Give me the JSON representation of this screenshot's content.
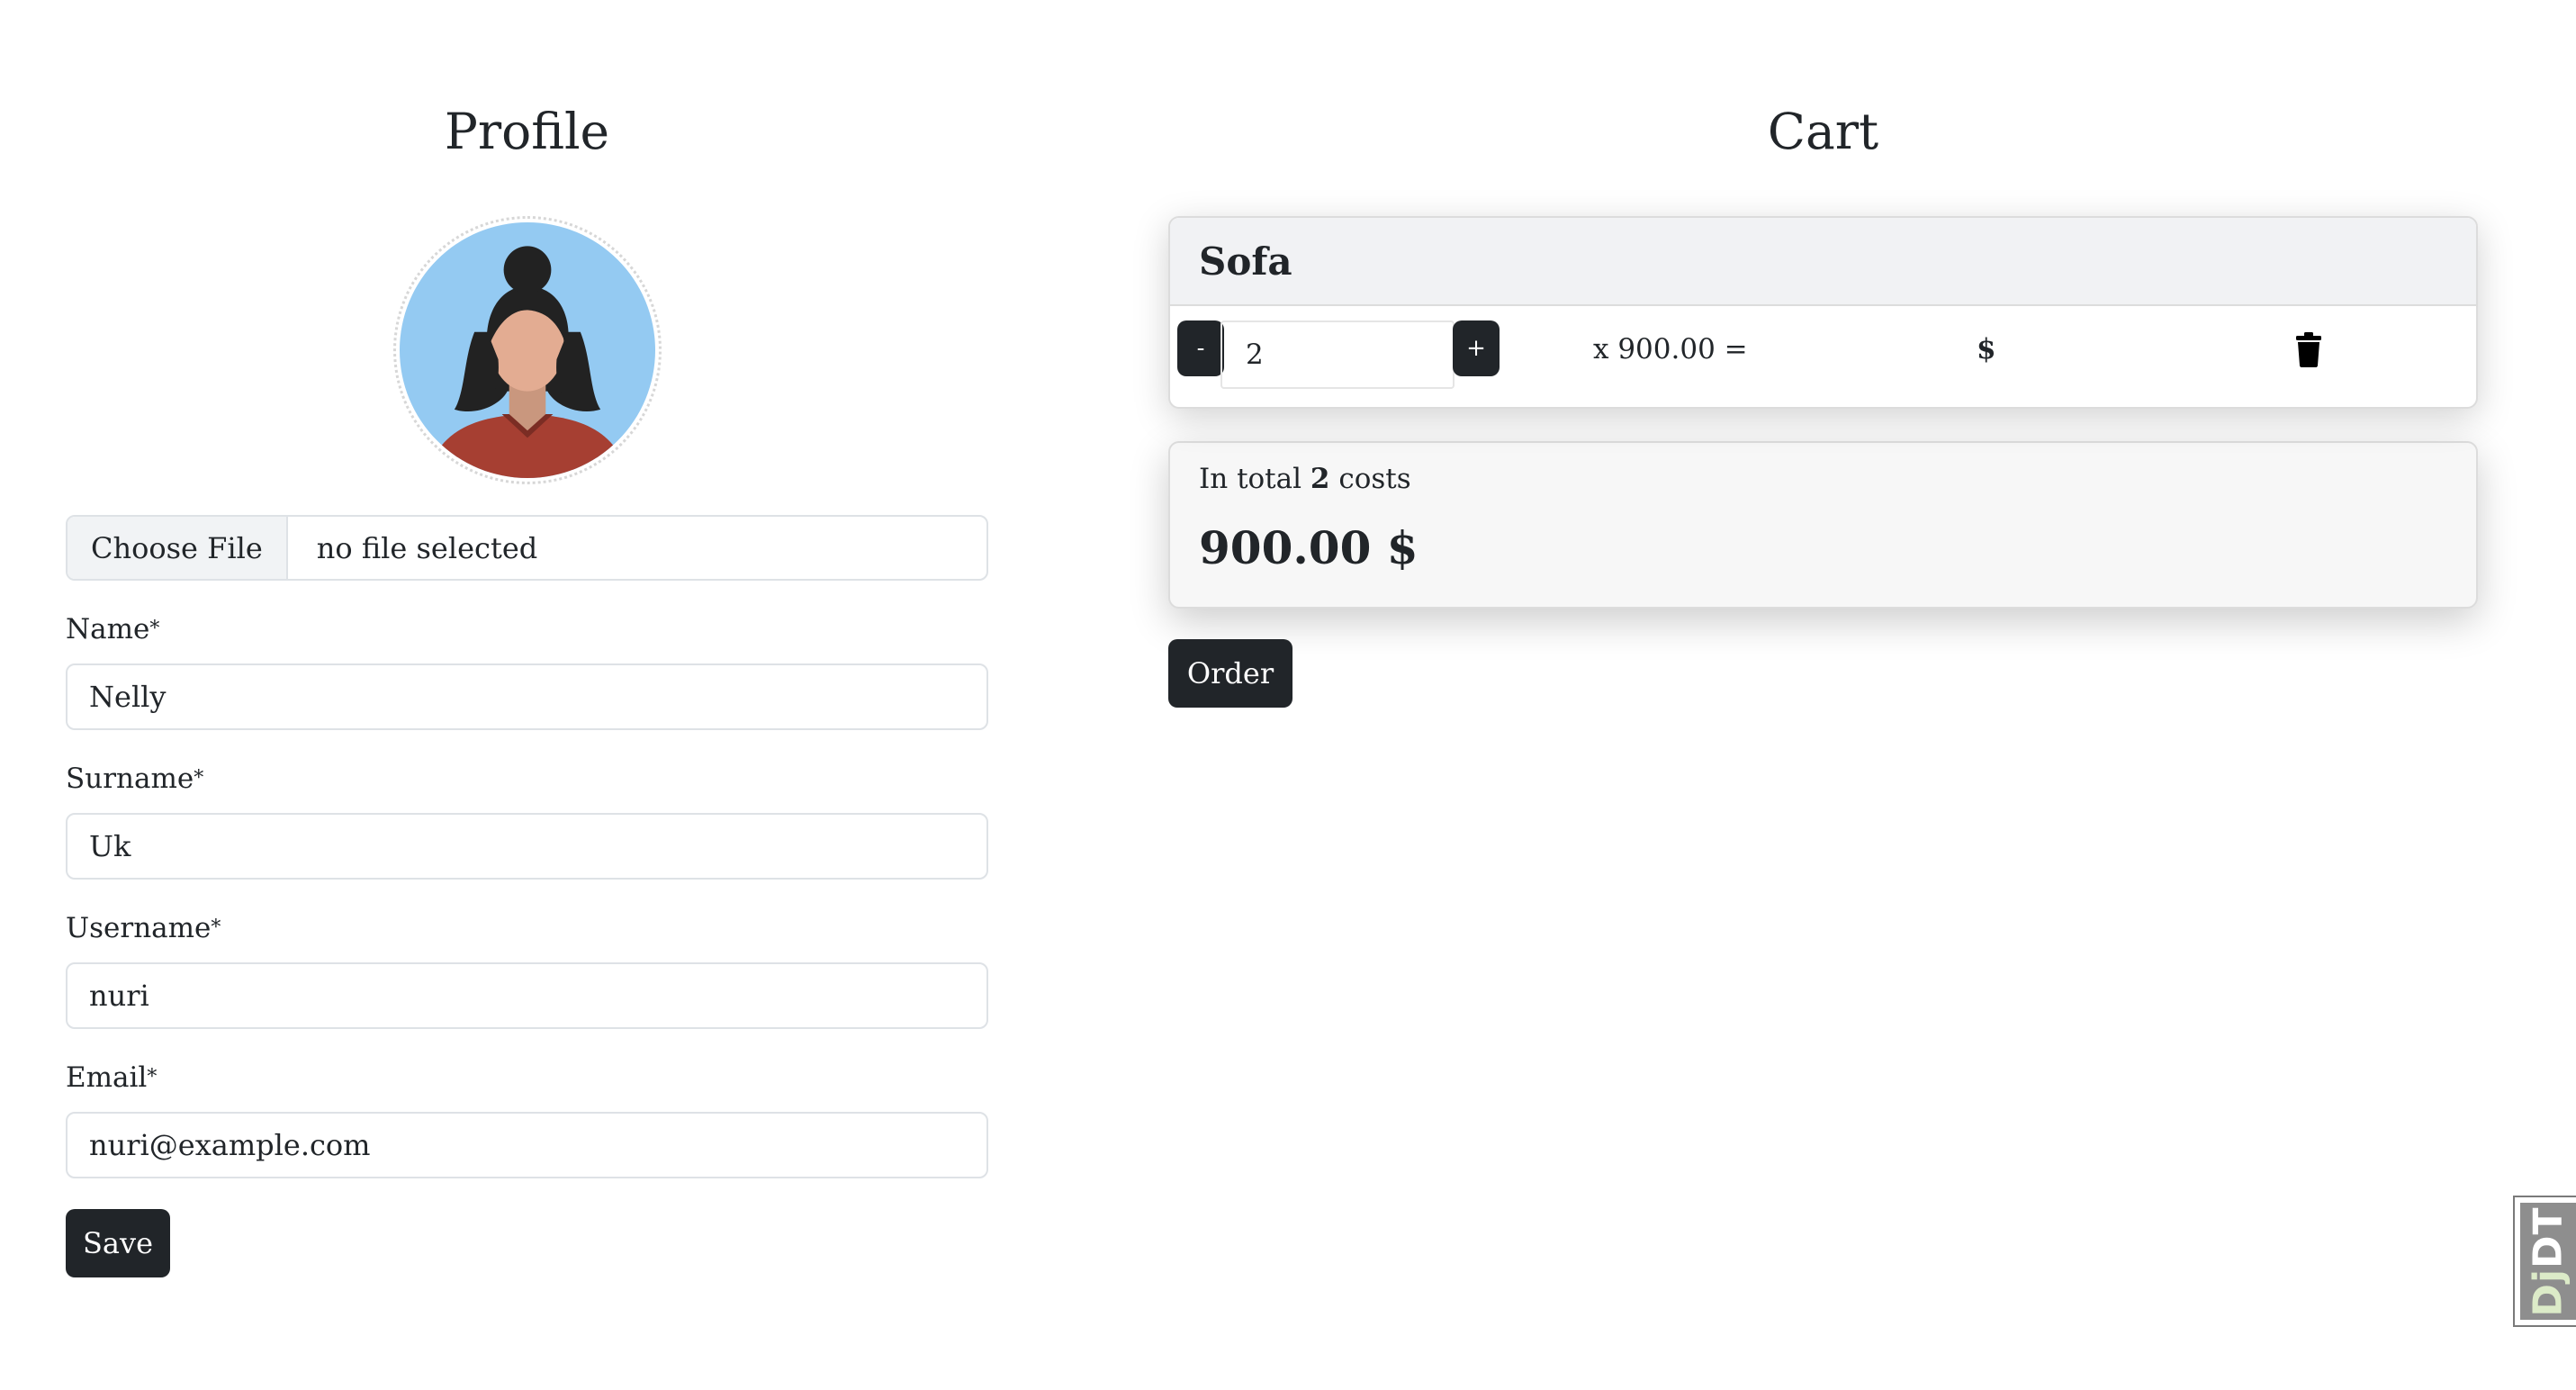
{
  "profile": {
    "title": "Profile",
    "file_input": {
      "button_label": "Choose File",
      "status": "no file selected"
    },
    "fields": [
      {
        "label": "Name",
        "required_mark": "*",
        "value": "Nelly"
      },
      {
        "label": "Surname",
        "required_mark": "*",
        "value": "Uk"
      },
      {
        "label": "Username",
        "required_mark": "*",
        "value": "nuri"
      },
      {
        "label": "Email",
        "required_mark": "*",
        "value": "nuri@example.com"
      }
    ],
    "save_label": "Save"
  },
  "cart": {
    "title": "Cart",
    "item": {
      "name": "Sofa",
      "minus_label": "-",
      "quantity": "2",
      "plus_label": "+",
      "price_text": "x 900.00 =",
      "currency_text": "$",
      "delete_icon": "trash-icon"
    },
    "total": {
      "prefix": "In total ",
      "count": "2",
      "suffix": " costs",
      "amount": "900.00 $"
    },
    "order_label": "Order"
  },
  "debug_toolbar": {
    "dj": "Dj",
    "dt": "DT"
  },
  "colors": {
    "button_dark": "#212529",
    "avatar_bg": "#94caf2",
    "card_header": "#f1f2f4"
  }
}
